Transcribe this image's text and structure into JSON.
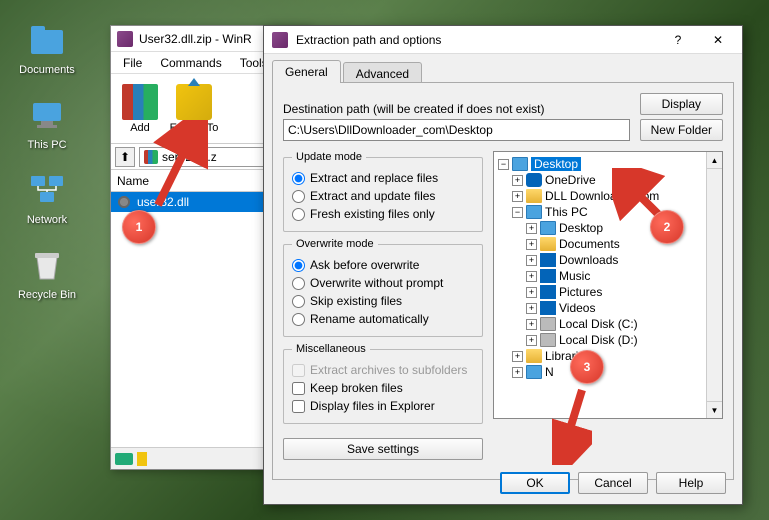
{
  "desktop": {
    "icons": [
      "Documents",
      "This PC",
      "Network",
      "Recycle Bin"
    ]
  },
  "winrar": {
    "title": "User32.dll.zip - WinR",
    "menu": [
      "File",
      "Commands",
      "Tools"
    ],
    "toolbar": {
      "add": "Add",
      "extract": "Extract To"
    },
    "path_file": "ser32.dll.z",
    "col_name": "Name",
    "file_row": "user32.dll"
  },
  "dialog": {
    "title": "Extraction path and options",
    "tabs": {
      "general": "General",
      "advanced": "Advanced"
    },
    "dest_label": "Destination path (will be created if does not exist)",
    "dest_value": "C:\\Users\\DllDownloader_com\\Desktop",
    "display_btn": "Display",
    "newfolder_btn": "New Folder",
    "update_mode": {
      "legend": "Update mode",
      "opt1": "Extract and replace files",
      "opt2": "Extract and update files",
      "opt3": "Fresh existing files only"
    },
    "overwrite_mode": {
      "legend": "Overwrite mode",
      "opt1": "Ask before overwrite",
      "opt2": "Overwrite without prompt",
      "opt3": "Skip existing files",
      "opt4": "Rename automatically"
    },
    "misc": {
      "legend": "Miscellaneous",
      "opt1": "Extract archives to subfolders",
      "opt2": "Keep broken files",
      "opt3": "Display files in Explorer"
    },
    "save_btn": "Save settings",
    "tree": {
      "desktop": "Desktop",
      "onedrive": "OneDrive",
      "dll": "DLL Downloader.com",
      "thispc": "This PC",
      "pc_desktop": "Desktop",
      "documents": "Documents",
      "downloads": "Downloads",
      "music": "Music",
      "pictures": "Pictures",
      "videos": "Videos",
      "diskc": "Local Disk (C:)",
      "diskd": "Local Disk (D:)",
      "libraries": "Libraries",
      "network": "N"
    },
    "ok": "OK",
    "cancel": "Cancel",
    "help": "Help"
  },
  "annotations": {
    "a1": "1",
    "a2": "2",
    "a3": "3"
  }
}
